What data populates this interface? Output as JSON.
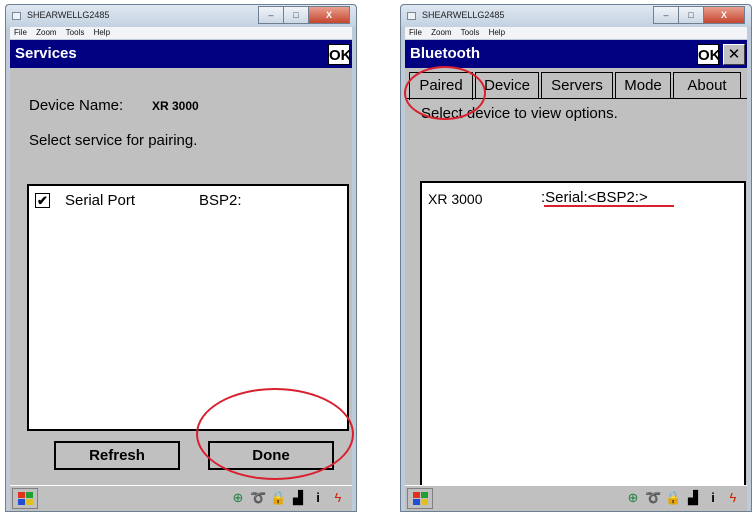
{
  "left_window": {
    "title": "SHEARWELLG2485",
    "menu": [
      "File",
      "Zoom",
      "Tools",
      "Help"
    ],
    "header_title": "Services",
    "ok_label": "OK",
    "device_name_label": "Device Name:",
    "device_name_value": "XR 3000",
    "instruction": "Select service for pairing.",
    "services": [
      {
        "checked": true,
        "name": "Serial Port",
        "port": "BSP2:"
      }
    ],
    "refresh_label": "Refresh",
    "done_label": "Done"
  },
  "right_window": {
    "title": "SHEARWELLG2485",
    "menu": [
      "File",
      "Zoom",
      "Tools",
      "Help"
    ],
    "header_title": "Bluetooth",
    "ok_label": "OK",
    "close_label": "✕",
    "tabs": [
      "Paired",
      "Device",
      "Servers",
      "Mode",
      "About"
    ],
    "active_tab": "Paired",
    "instruction": "Select device to view options.",
    "devices": [
      {
        "name": "XR 3000",
        "service": ":Serial:<BSP2:>"
      }
    ]
  },
  "titlebar_buttons": {
    "minimize": "–",
    "maximize": "□",
    "close": "X"
  },
  "colors": {
    "header": "#000080",
    "annotation": "#d8202e",
    "screen": "#c0c0c0"
  }
}
